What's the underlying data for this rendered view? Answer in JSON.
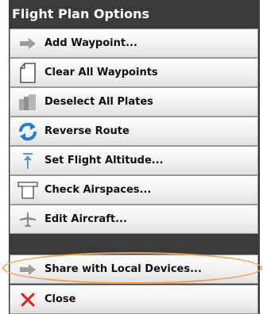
{
  "title": "Flight Plan Options",
  "highlight_color": "#f0a050",
  "items": [
    {
      "label": "Add Waypoint...",
      "icon": "arrow-right-icon"
    },
    {
      "label": "Clear All Waypoints",
      "icon": "blank-page-icon"
    },
    {
      "label": "Deselect All Plates",
      "icon": "plates-stack-icon"
    },
    {
      "label": "Reverse Route",
      "icon": "reverse-arrows-icon"
    },
    {
      "label": "Set Flight Altitude...",
      "icon": "altitude-icon"
    },
    {
      "label": "Check Airspaces...",
      "icon": "airspace-icon"
    },
    {
      "label": "Edit Aircraft...",
      "icon": "aircraft-icon"
    },
    {
      "label": "Share with Local Devices...",
      "icon": "share-arrow-icon"
    },
    {
      "label": "Close",
      "icon": "close-icon"
    }
  ]
}
